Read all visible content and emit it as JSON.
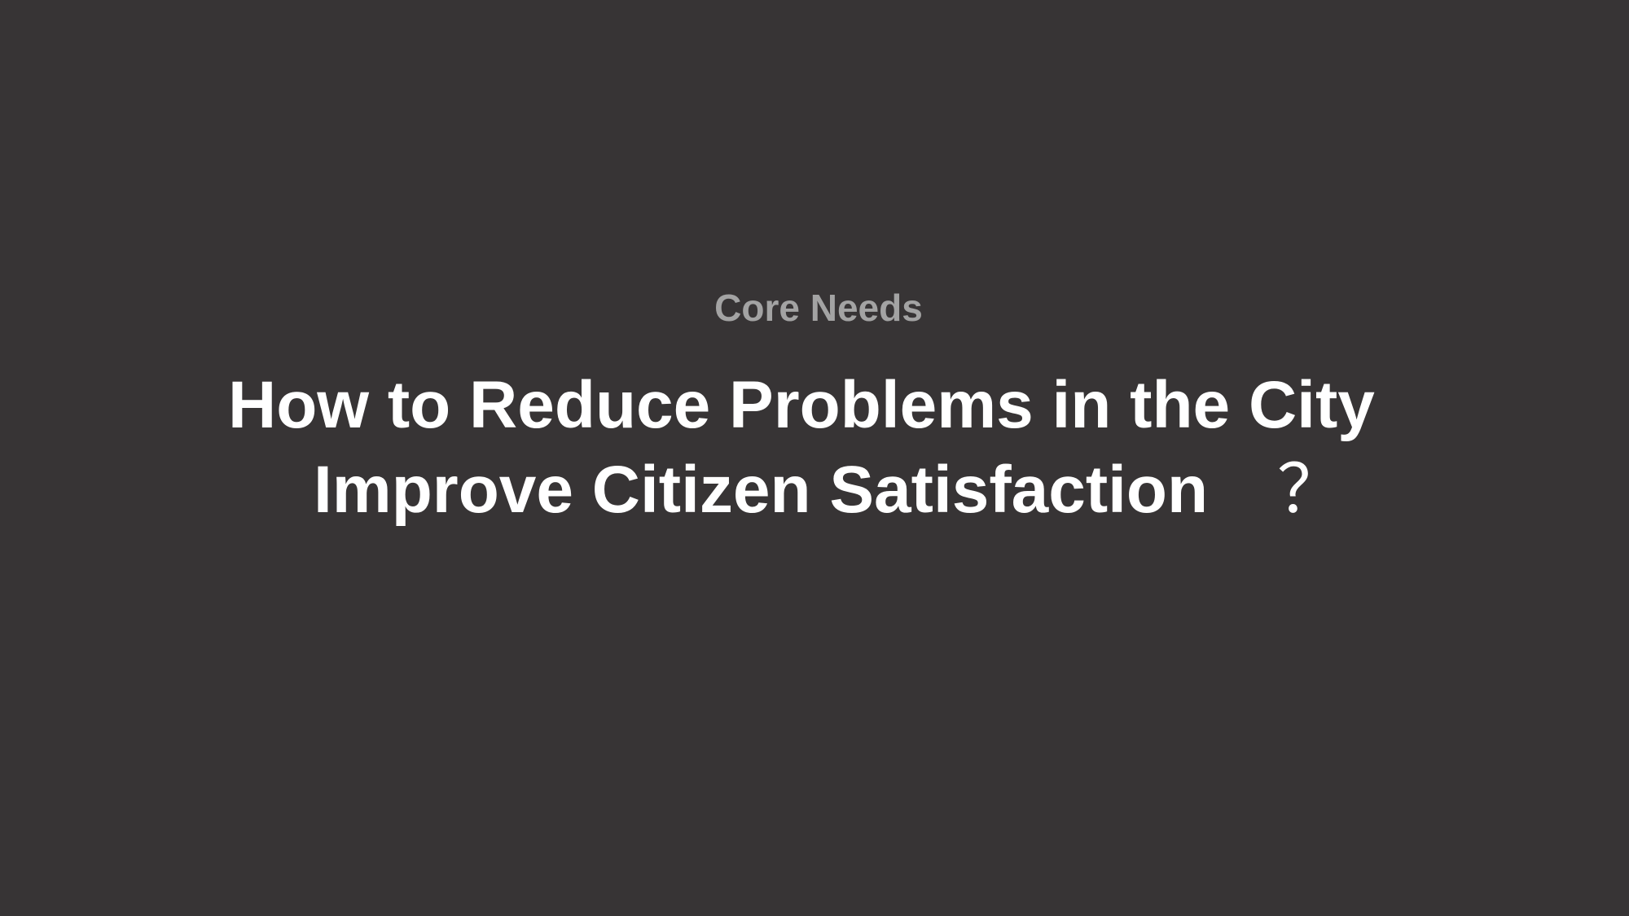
{
  "slide": {
    "eyebrow": "Core Needs",
    "headline_line1": "How to Reduce Problems in the City",
    "headline_line2": "Improve Citizen Satisfaction",
    "question_mark": "？"
  },
  "colors": {
    "background": "#373435",
    "eyebrow": "#a3a3a3",
    "headline": "#ffffff"
  }
}
